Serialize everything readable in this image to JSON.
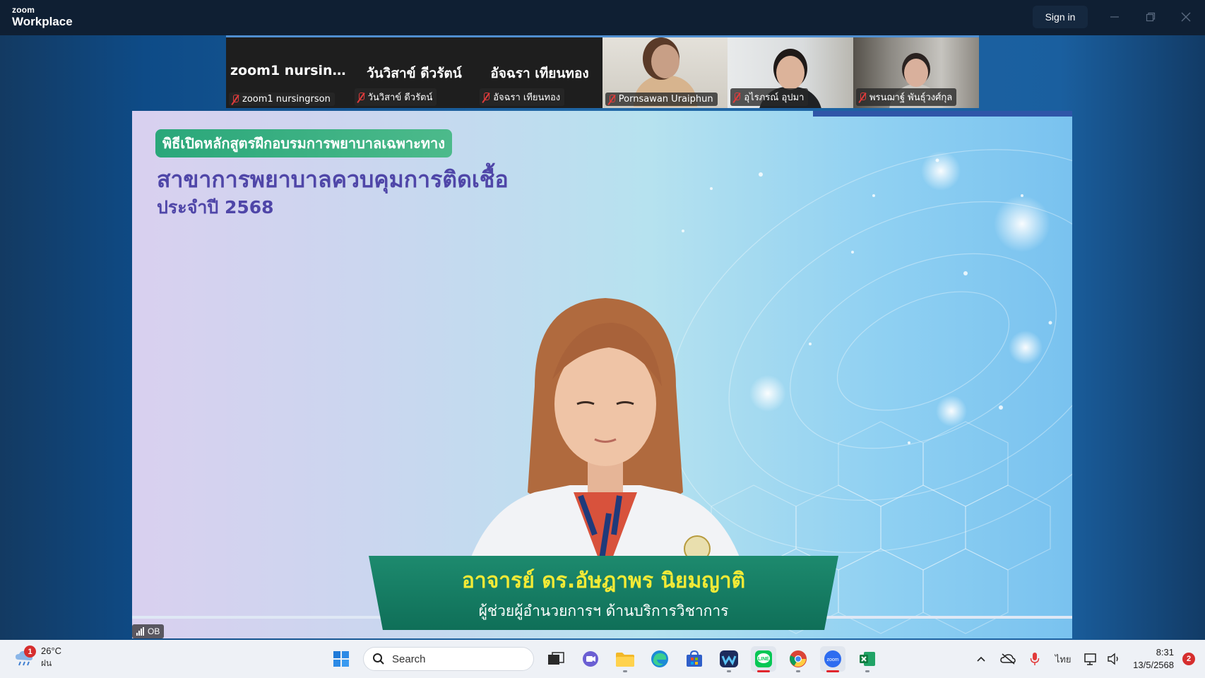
{
  "app": {
    "brand_small": "zoom",
    "brand_big": "Workplace",
    "sign_in_label": "Sign in"
  },
  "participants": [
    {
      "big_name": "zoom1 nursingr...",
      "label": "zoom1 nursingrson",
      "muted": true,
      "video": false
    },
    {
      "big_name": "วันวิสาข์ ดีวรัตน์",
      "label": "วันวิสาข์ ดีวรัตน์",
      "muted": true,
      "video": false
    },
    {
      "big_name": "อัจฉรา เทียนทอง",
      "label": "อัจฉรา เทียนทอง",
      "muted": true,
      "video": false
    },
    {
      "big_name": "",
      "label": "Pornsawan Uraiphun",
      "muted": true,
      "video": true
    },
    {
      "big_name": "",
      "label": "อุไรภรณ์ อุปมา",
      "muted": true,
      "video": true
    },
    {
      "big_name": "",
      "label": "พรนฌาฐ์ พันธุ์วงศ์กุล",
      "muted": true,
      "video": true
    }
  ],
  "share": {
    "tagline": "พิธีเปิดหลักสูตรฝึกอบรมการพยาบาลเฉพาะทาง",
    "headline": "สาขาการพยาบาลควบคุมการติดเชื้อ",
    "subhead": "ประจำปี 2568",
    "speaker_name": "อาจารย์ ดร.อัษฎาพร นิยมญาติ",
    "speaker_role": "ผู้ช่วยผู้อำนวยการฯ ด้านบริการวิชาการ",
    "quality_label": "OB"
  },
  "taskbar": {
    "weather_temp": "26°C",
    "weather_cond": "ฝน",
    "weather_badge": "1",
    "search_placeholder": "Search",
    "language": "ไทย",
    "time": "8:31",
    "date": "13/5/2568",
    "notification_count": "2"
  },
  "colors": {
    "accent_green": "#2aa77a",
    "headline_purple": "#4f46a8",
    "name_yellow": "#f3ea36",
    "mute_red": "#e23b3b"
  }
}
